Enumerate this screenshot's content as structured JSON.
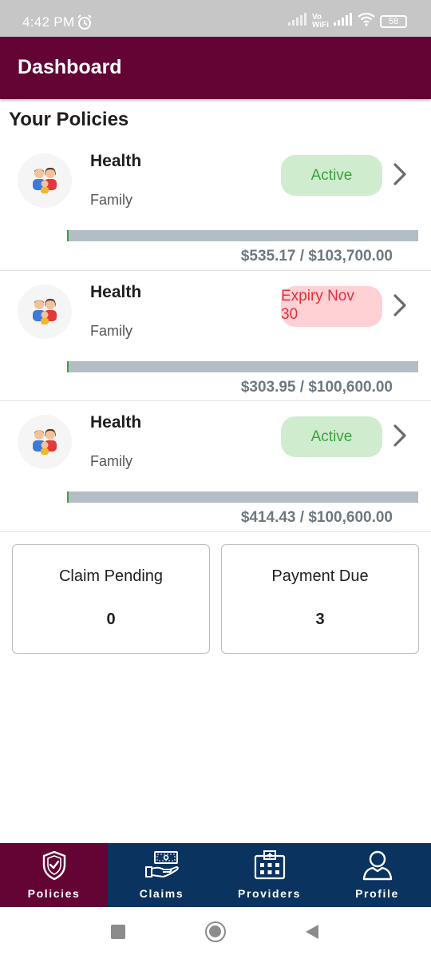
{
  "status_bar": {
    "time": "4:42 PM",
    "network_label_top": "Vo",
    "network_label_bottom": "WiFi",
    "battery": "58"
  },
  "header": {
    "title": "Dashboard"
  },
  "section_title": "Your Policies",
  "policies": [
    {
      "name": "Health",
      "type": "Family",
      "status": "Active",
      "status_kind": "active",
      "used": "$535.17",
      "total": "$103,700.00",
      "amount": "$535.17 / $103,700.00",
      "progress_fraction": 0.005
    },
    {
      "name": "Health",
      "type": "Family",
      "status_line1": "Expiry Nov",
      "status_line2": "30",
      "status_kind": "expiry",
      "amount": "$303.95 / $100,600.00",
      "progress_fraction": 0.003
    },
    {
      "name": "Health",
      "type": "Family",
      "status": "Active",
      "status_kind": "active",
      "amount": "$414.43 / $100,600.00",
      "progress_fraction": 0.004
    }
  ],
  "stats": {
    "claim_pending": {
      "label": "Claim Pending",
      "value": "0"
    },
    "payment_due": {
      "label": "Payment Due",
      "value": "3"
    }
  },
  "bottom_nav": {
    "items": [
      {
        "label": "Policies",
        "icon": "shield-check-icon",
        "selected": true
      },
      {
        "label": "Claims",
        "icon": "cash-hand-icon",
        "selected": false
      },
      {
        "label": "Providers",
        "icon": "hospital-icon",
        "selected": false
      },
      {
        "label": "Profile",
        "icon": "person-icon",
        "selected": false
      }
    ]
  },
  "colors": {
    "header": "#630435",
    "nav": "#0b335f",
    "active_badge_bg": "#cfeccf",
    "active_badge_text": "#3aa33a",
    "expiry_badge_bg": "#ffd0d4",
    "expiry_badge_text": "#e0303a"
  }
}
